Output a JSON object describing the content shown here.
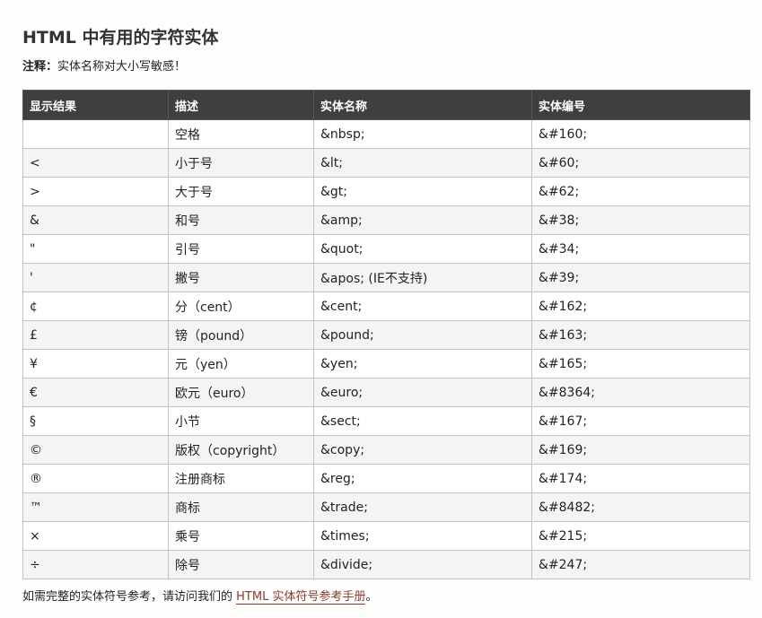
{
  "title": "HTML 中有用的字符实体",
  "note": {
    "label": "注释：",
    "text": "实体名称对大小写敏感！"
  },
  "table": {
    "headers": [
      "显示结果",
      "描述",
      "实体名称",
      "实体编号"
    ],
    "rows": [
      [
        "",
        "空格",
        "&nbsp;",
        "&#160;"
      ],
      [
        "<",
        "小于号",
        "&lt;",
        "&#60;"
      ],
      [
        ">",
        "大于号",
        "&gt;",
        "&#62;"
      ],
      [
        "&",
        "和号",
        "&amp;",
        "&#38;"
      ],
      [
        "\"",
        "引号",
        "&quot;",
        "&#34;"
      ],
      [
        "'",
        "撇号",
        "&apos; (IE不支持)",
        "&#39;"
      ],
      [
        "¢",
        "分（cent）",
        "&cent;",
        "&#162;"
      ],
      [
        "£",
        "镑（pound）",
        "&pound;",
        "&#163;"
      ],
      [
        "¥",
        "元（yen）",
        "&yen;",
        "&#165;"
      ],
      [
        "€",
        "欧元（euro）",
        "&euro;",
        "&#8364;"
      ],
      [
        "§",
        "小节",
        "&sect;",
        "&#167;"
      ],
      [
        "©",
        "版权（copyright）",
        "&copy;",
        "&#169;"
      ],
      [
        "®",
        "注册商标",
        "&reg;",
        "&#174;"
      ],
      [
        "™",
        "商标",
        "&trade;",
        "&#8482;"
      ],
      [
        "×",
        "乘号",
        "&times;",
        "&#215;"
      ],
      [
        "÷",
        "除号",
        "&divide;",
        "&#247;"
      ]
    ]
  },
  "footer": {
    "text": "如需完整的实体符号参考，请访问我们的 ",
    "link": "HTML 实体符号参考手册",
    "end": "。"
  },
  "colors": {
    "header_bg": "#3f3f3f",
    "link": "#8b3a2f"
  }
}
